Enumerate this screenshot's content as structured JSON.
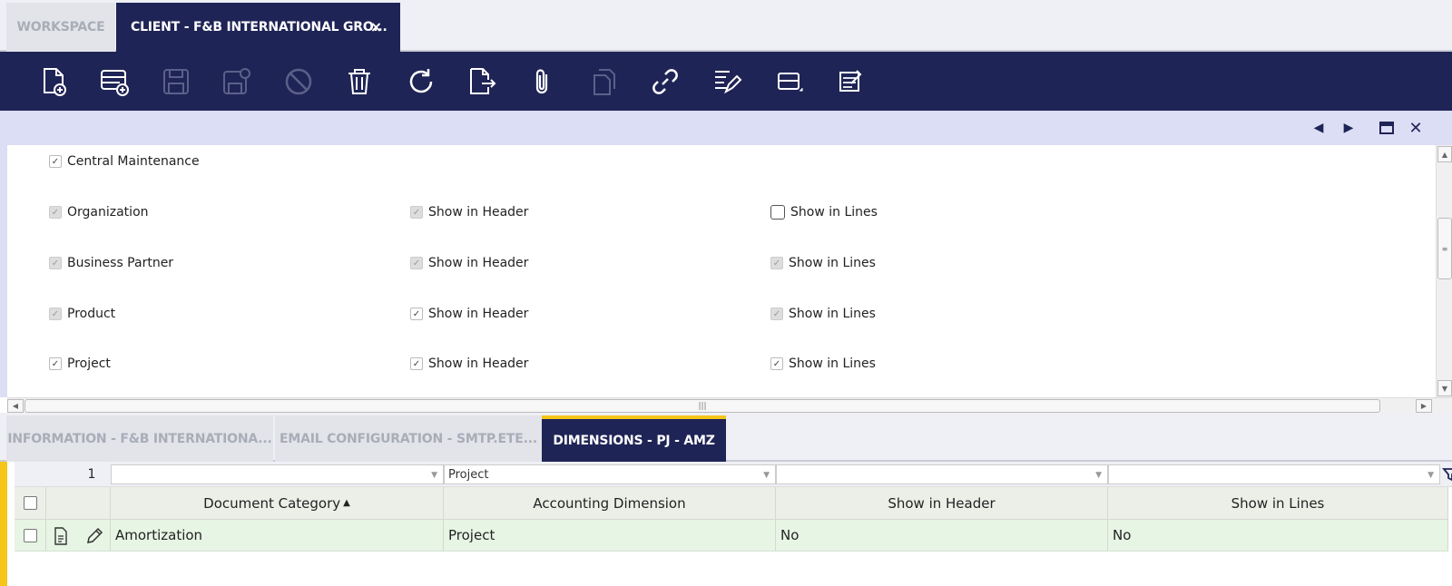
{
  "tabs": {
    "workspace": "WORKSPACE",
    "client": "CLIENT - F&B INTERNATIONAL GRO...",
    "close": "×"
  },
  "form": {
    "central_maintenance": "Central Maintenance",
    "rows": [
      {
        "label": "Organization",
        "header": "Show in Header",
        "lines": "Show in Lines"
      },
      {
        "label": "Business Partner",
        "header": "Show in Header",
        "lines": "Show in Lines"
      },
      {
        "label": "Product",
        "header": "Show in Header",
        "lines": "Show in Lines"
      },
      {
        "label": "Project",
        "header": "Show in Header",
        "lines": "Show in Lines"
      }
    ]
  },
  "sub_tabs": [
    "INFORMATION - F&B INTERNATIONA...",
    "EMAIL CONFIGURATION - SMTP.ETE...",
    "DIMENSIONS - PJ - AMZ"
  ],
  "grid": {
    "record_count": "1",
    "filter_accounting_dimension": "Project",
    "headers": {
      "document_category": "Document Category",
      "accounting_dimension": "Accounting Dimension",
      "show_in_header": "Show in Header",
      "show_in_lines": "Show in Lines"
    },
    "rows": [
      {
        "document_category": "Amortization",
        "accounting_dimension": "Project",
        "show_in_header": "No",
        "show_in_lines": "No"
      }
    ]
  },
  "colors": {
    "navy": "#1f2456",
    "accent_yellow": "#f5c518",
    "row_green": "#e7f5e4"
  }
}
